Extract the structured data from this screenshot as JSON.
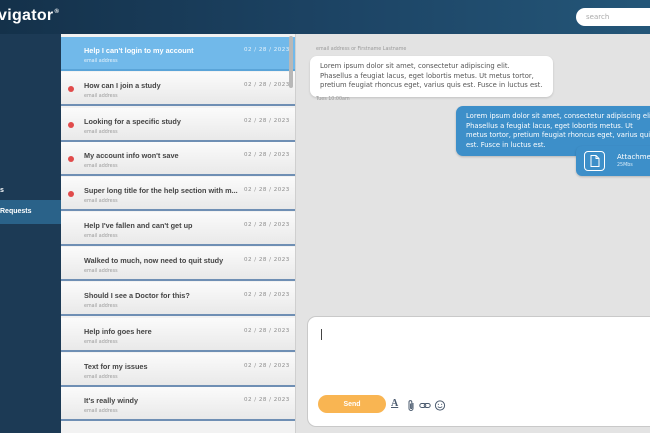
{
  "app": {
    "logo_text": "vigator",
    "logo_mark": "®"
  },
  "search": {
    "placeholder": "search"
  },
  "sidebar": {
    "items": [
      {
        "label": "s"
      },
      {
        "label": "Requests"
      }
    ]
  },
  "tickets": [
    {
      "title": "Help I can't login to my account",
      "date": "02 / 28 / 2023",
      "sub": "email address",
      "unread": false,
      "selected": true
    },
    {
      "title": "How can I join a study",
      "date": "02 / 28 / 2023",
      "sub": "email address",
      "unread": true
    },
    {
      "title": "Looking for a specific study",
      "date": "02 / 28 / 2023",
      "sub": "email address",
      "unread": true
    },
    {
      "title": "My account info won't save",
      "date": "02 / 28 / 2023",
      "sub": "email address",
      "unread": true
    },
    {
      "title": "Super long title for the help section with m...",
      "date": "02 / 28 / 2023",
      "sub": "email address",
      "unread": true
    },
    {
      "title": "Help I've fallen and can't get up",
      "date": "02 / 28 / 2023",
      "sub": "email address",
      "unread": false
    },
    {
      "title": "Walked to much, now need to quit study",
      "date": "02 / 28 / 2023",
      "sub": "email address",
      "unread": false
    },
    {
      "title": "Should I see a Doctor for this?",
      "date": "02 / 28 / 2023",
      "sub": "email address",
      "unread": false
    },
    {
      "title": "Help info goes here",
      "date": "02 / 28 / 2023",
      "sub": "email address",
      "unread": false
    },
    {
      "title": "Text for my issues",
      "date": "02 / 28 / 2023",
      "sub": "email address",
      "unread": false
    },
    {
      "title": "It's really windy",
      "date": "02 / 28 / 2023",
      "sub": "email address",
      "unread": false
    }
  ],
  "chat": {
    "sender_label": "email address or Firstname Lastname",
    "incoming_text": "Lorem ipsum dolor sit amet, consectetur adipiscing elit. Phasellus a feugiat lacus, eget lobortis metus. Ut metus tortor, pretium feugiat rhoncus eget, varius quis est. Fusce in luctus est.",
    "time_label": "Tues 10:00am",
    "outgoing_text": "Lorem ipsum dolor sit amet, consectetur adipiscing elit. Phasellus a feugiat lacus, eget lobortis metus. Ut metus tortor, pretium feugiat rhoncus eget, varius quis est. Fusce in luctus est.",
    "attachment_name": "Attachment",
    "attachment_size": "25Mbs"
  },
  "composer": {
    "send_label": "Send",
    "format_glyph": "A"
  },
  "colors": {
    "accent_blue": "#3d8fc9",
    "selected_row": "#71b9ea",
    "send_button": "#f9b552",
    "unread_dot": "#e14b4b",
    "sidebar": "#1c3a55"
  }
}
